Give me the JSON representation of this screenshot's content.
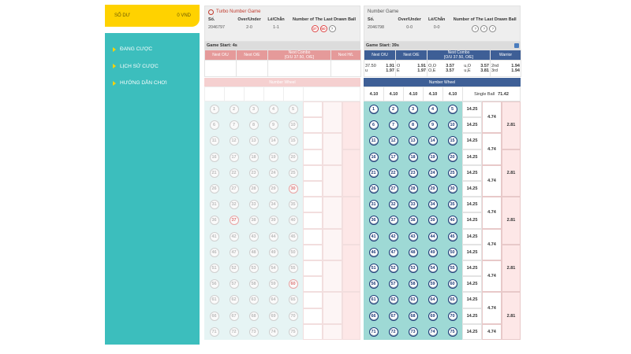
{
  "sidebar": {
    "balance_label": "SỐ DƯ",
    "balance_value": "0 VND",
    "items": [
      {
        "label": "ĐANG CƯỢC"
      },
      {
        "label": "LỊCH SỬ CƯỢC"
      },
      {
        "label": "HƯỚNG DẪN CHƠI"
      }
    ]
  },
  "turbo": {
    "title": "Turbo Number Game",
    "col_so": "Số.",
    "col_ou": "Over/Under",
    "col_lc": "Lẻ/Chẵn",
    "col_last": "Number of The Last Drawn Ball",
    "so_value": "2046797",
    "ou_value": "2-0",
    "lc_value": "1-1",
    "last_balls": [
      "37",
      "60",
      "?"
    ],
    "game_start": "Game Start: 4s",
    "h_next_ou": "Next O/U",
    "h_next_oe": "Next O/E",
    "h_combo": "Next Combo",
    "h_combo_sub": "[O/U 37.50, O/E]",
    "h_next_hl": "Next H/L",
    "wheel_label": "Number Wheel"
  },
  "number": {
    "title": "Number Game",
    "col_so": "Số.",
    "col_ou": "Over/Under",
    "col_lc": "Lẻ/Chẵn",
    "col_last": "Number of The Last Drawn Ball",
    "so_value": "2046798",
    "ou_value": "0-0",
    "lc_value": "0-0",
    "last_balls": [
      "?",
      "?",
      "?"
    ],
    "game_start": "Game Start: 39s",
    "h_next_ou": "Next O/U",
    "h_next_oe": "Next O/E",
    "h_combo": "Next Combo",
    "h_combo_sub": "[O/U 37.50, O/E]",
    "h_warrior": "Warrior",
    "odds": {
      "ou_line": "37.50",
      "o_label": "o",
      "u_label": "u",
      "ou_o": "1.91",
      "ou_u": "1.97",
      "oe_o_label": "O",
      "oe_e_label": "E",
      "oe_o": "1.91",
      "oe_e": "1.97",
      "combo_r1_l": "O,O",
      "combo_r1_v": "3.57",
      "combo_r1_l2": "u,O",
      "combo_r1_v2": "3.57",
      "combo_r2_l": "O,E",
      "combo_r2_v": "3.57",
      "combo_r2_l2": "u,E",
      "combo_r2_v2": "3.81",
      "w1_label": "2nd",
      "w1_val": "1.94",
      "w2_label": "3rd",
      "w2_val": "1.94"
    },
    "wheel_label": "Number Wheel",
    "wheel_odds": [
      "4.10",
      "4.10",
      "4.10",
      "4.10",
      "4.10"
    ],
    "single_ball_label": "Single Ball",
    "single_ball_odds": "71.42",
    "row_odds": "14.25",
    "pair_odds": "4.74",
    "quad_odds": "2.81"
  },
  "colors": {
    "accent": "#ffd200",
    "sidebar": "#3cbebd",
    "turbo_header": "#e59a9a",
    "number_header": "#3e5f96"
  }
}
